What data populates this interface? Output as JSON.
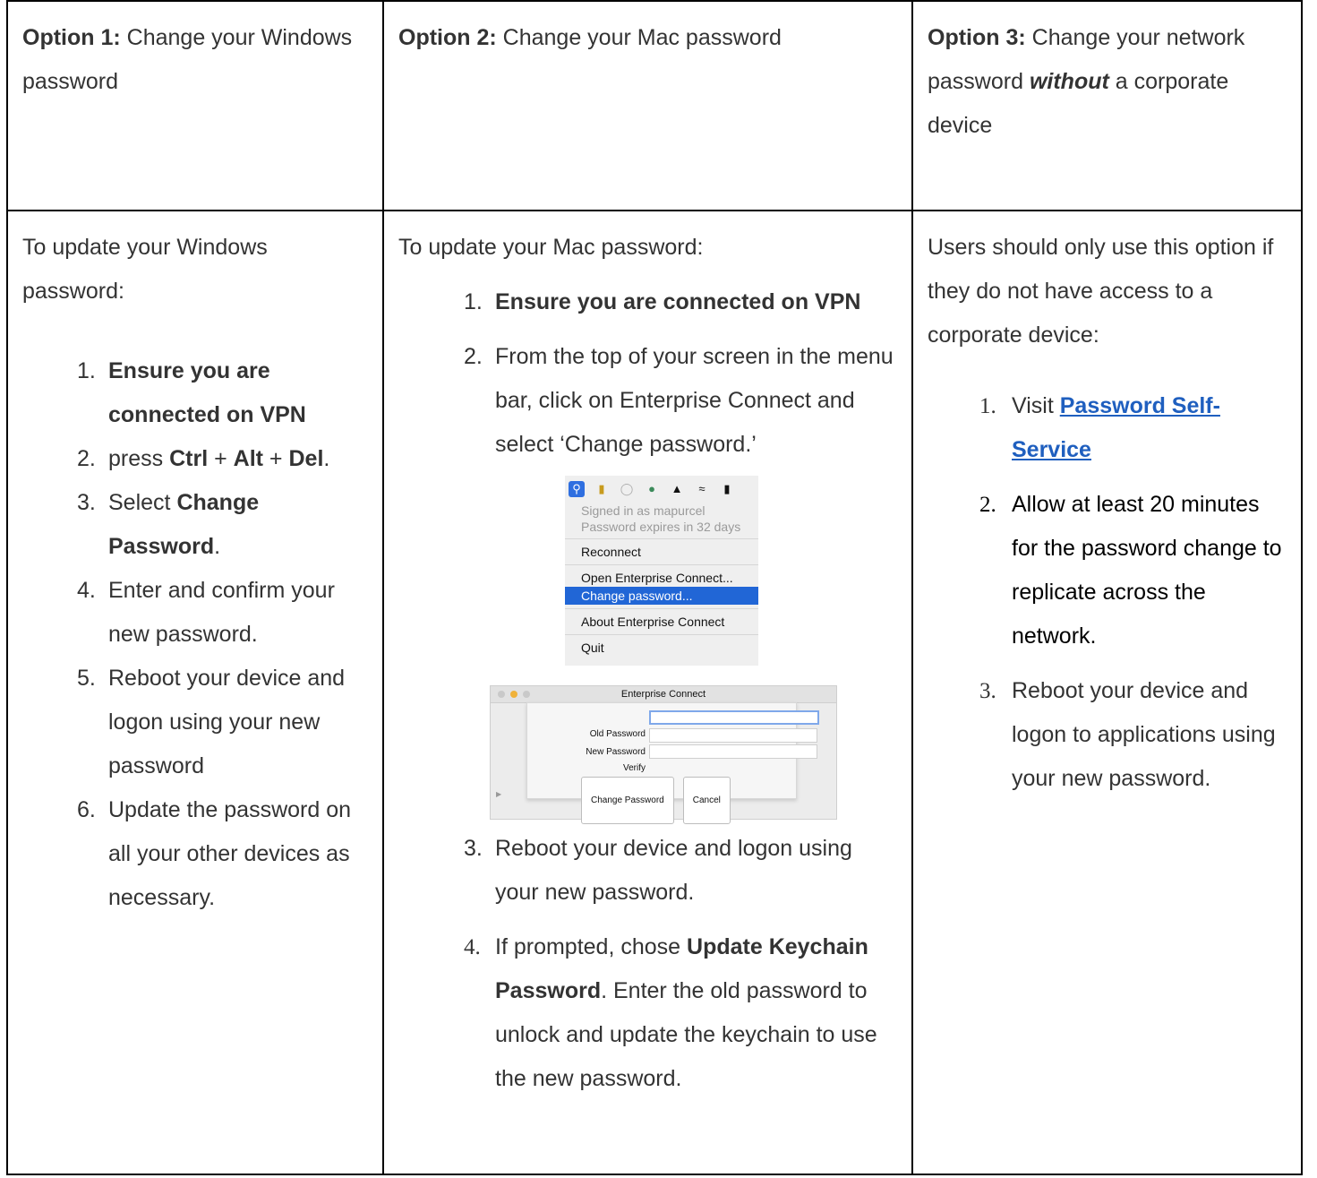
{
  "header": {
    "opt1_label": "Option 1:",
    "opt1_text": " Change your Windows password",
    "opt2_label": "Option 2:",
    "opt2_text": " Change your Mac password",
    "opt3_label": "Option 3:",
    "opt3_text_a": " Change your network password ",
    "opt3_em": "without",
    "opt3_text_b": " a corporate device"
  },
  "windows": {
    "intro": "To update your Windows password:",
    "steps": [
      {
        "num": "1.",
        "bold": "Ensure you are connected on VPN"
      },
      {
        "num": "2.",
        "pre": "press ",
        "k1": "Ctrl",
        "plus1": " + ",
        "k2": "Alt",
        "plus2": " + ",
        "k3": "Del",
        "post": "."
      },
      {
        "num": "3.",
        "pre": "Select ",
        "bold": "Change Password",
        "post": "."
      },
      {
        "num": "4.",
        "text": "Enter and confirm your new password."
      },
      {
        "num": "5.",
        "text": "Reboot your device and logon using your new password"
      },
      {
        "num": "6.",
        "text": "Update the password on all your other devices as necessary."
      }
    ]
  },
  "mac": {
    "intro": "To update your Mac password:",
    "steps": [
      {
        "num": "1.",
        "bold": "Ensure you are connected on VPN"
      },
      {
        "num": "2.",
        "text": "From the top of your screen in the menu bar, click on Enterprise Connect and select ‘Change password.’"
      },
      {
        "num": "3.",
        "text": "Reboot your device and logon using your new password."
      },
      {
        "num": "4.",
        "pre": "If prompted, chose ",
        "bold": "Update Keychain Password",
        "post": ". Enter the old password to unlock and update the keychain to use the new password."
      }
    ],
    "menu": {
      "info1": "Signed in as mapurcel",
      "info2": "Password expires in 32 days",
      "reconnect": "Reconnect",
      "open": "Open Enterprise Connect...",
      "change": "Change password...",
      "about": "About Enterprise Connect",
      "quit": "Quit"
    },
    "dialog": {
      "title": "Enterprise Connect",
      "old": "Old Password",
      "new": "New Password",
      "verify": "Verify",
      "change_btn": "Change Password",
      "cancel_btn": "Cancel"
    }
  },
  "network": {
    "intro": "Users should only use this option if they do not have access to a corporate device:",
    "steps": [
      {
        "num": "1.",
        "pre": "Visit ",
        "link": "Password Self-Service"
      },
      {
        "num": "2.",
        "text": "Allow at least 20 minutes for the password change to replicate across the network."
      },
      {
        "num": "3.",
        "text": "Reboot your device and logon to applications using your new password."
      }
    ]
  },
  "colors": {
    "link": "#1f5fbf",
    "menu_highlight": "#2166d6",
    "border": "#000000"
  }
}
